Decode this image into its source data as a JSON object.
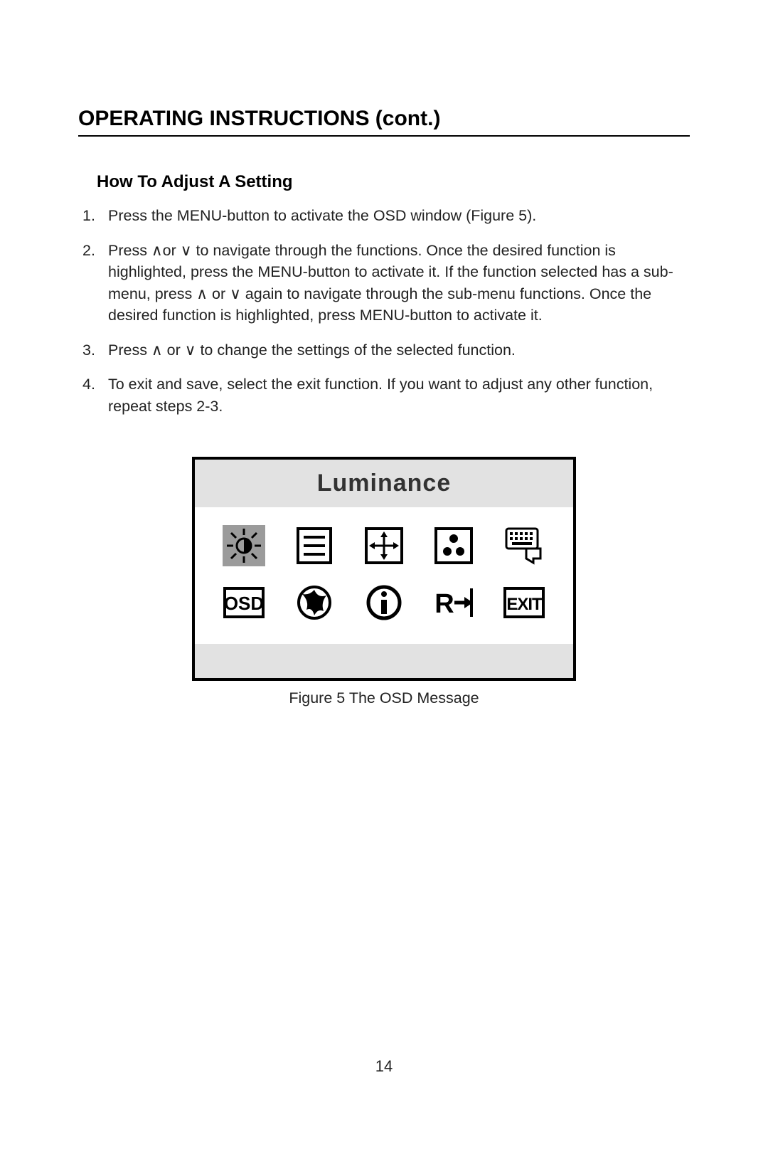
{
  "heading": "OPERATING INSTRUCTIONS (cont.)",
  "subheading": "How To Adjust A Setting",
  "steps": [
    {
      "num": "1.",
      "text": "Press the MENU-button to activate the OSD window (Figure 5)."
    },
    {
      "num": "2.",
      "text": "Press ∧or ∨ to navigate through the functions. Once the desired function is highlighted, press the MENU-button  to activate it.  If the function selected has a sub-menu, press ∧ or ∨ again to navigate through the sub-menu functions.  Once the desired function is highlighted, press MENU-button to activate it."
    },
    {
      "num": "3.",
      "text": "Press ∧ or  ∨ to change the settings of the selected function."
    },
    {
      "num": "4.",
      "text": "To exit and save, select the exit function. If you want to adjust any other function, repeat steps 2-3."
    }
  ],
  "osd": {
    "title": "Luminance",
    "icons": [
      "luminance-icon",
      "menu-lines-icon",
      "move-icon",
      "color-dots-icon",
      "keyboard-drop-icon",
      "osd-text-icon",
      "globe-icon",
      "info-icon",
      "reset-icon",
      "exit-text-icon"
    ]
  },
  "figure_caption": "Figure 5    The  OSD  Message",
  "page_number": "14"
}
